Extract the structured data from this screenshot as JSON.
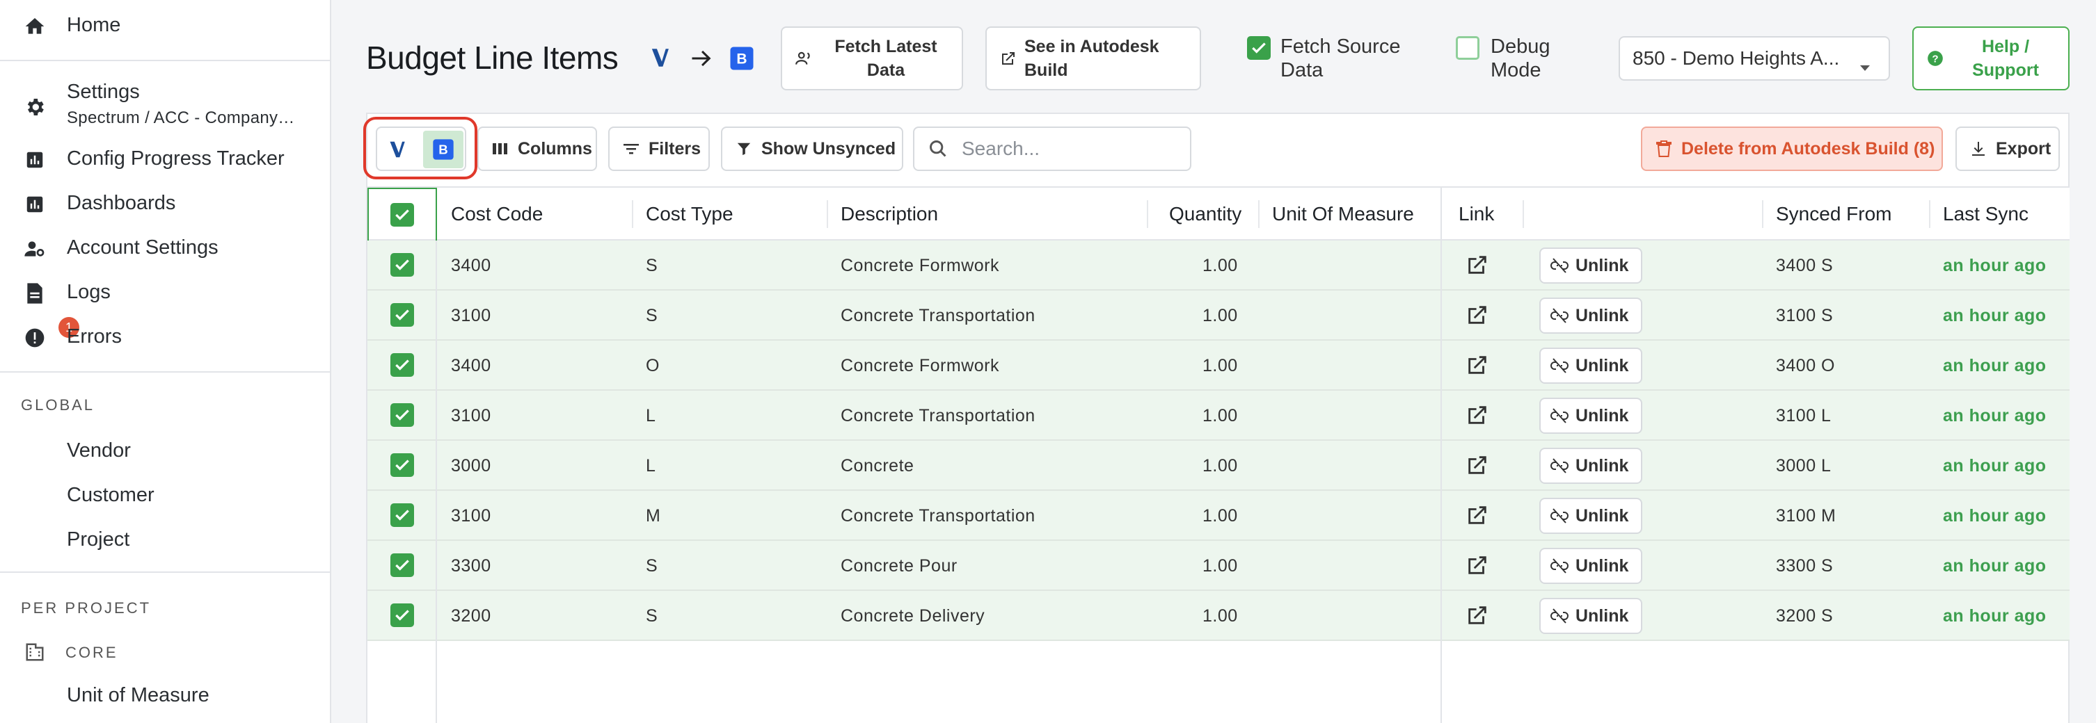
{
  "sidebar": {
    "home": "Home",
    "settings": "Settings",
    "settings_sub": "Spectrum / ACC - Company…",
    "config_tracker": "Config Progress Tracker",
    "dashboards": "Dashboards",
    "account_settings": "Account Settings",
    "logs": "Logs",
    "errors": "Errors",
    "errors_count": "1",
    "global_title": "GLOBAL",
    "global_items": [
      "Vendor",
      "Customer",
      "Project"
    ],
    "per_project_title": "PER PROJECT",
    "core_title": "CORE",
    "unit_of_measure": "Unit of Measure"
  },
  "header": {
    "title": "Budget Line Items",
    "fetch_latest": "Fetch Latest Data",
    "see_in_build": "See in Autodesk Build",
    "fetch_source_label": "Fetch Source Data",
    "debug_label": "Debug Mode",
    "project_select": "850 - Demo Heights A...",
    "help": "Help / Support"
  },
  "toolbar": {
    "columns": "Columns",
    "filters": "Filters",
    "show_unsynced": "Show Unsynced",
    "search_placeholder": "Search...",
    "delete_label": "Delete from Autodesk Build (8)",
    "export": "Export"
  },
  "table": {
    "headers": {
      "cost_code": "Cost Code",
      "cost_type": "Cost Type",
      "description": "Description",
      "quantity": "Quantity",
      "uom": "Unit Of Measure",
      "link": "Link",
      "synced_from": "Synced From",
      "last_sync": "Last Sync"
    },
    "unlink_label": "Unlink",
    "rows": [
      {
        "cost_code": "3400",
        "cost_type": "S",
        "description": "Concrete Formwork",
        "quantity": "1.00",
        "synced_from": "3400 S",
        "last_sync": "an hour ago"
      },
      {
        "cost_code": "3100",
        "cost_type": "S",
        "description": "Concrete Transportation",
        "quantity": "1.00",
        "synced_from": "3100 S",
        "last_sync": "an hour ago"
      },
      {
        "cost_code": "3400",
        "cost_type": "O",
        "description": "Concrete Formwork",
        "quantity": "1.00",
        "synced_from": "3400 O",
        "last_sync": "an hour ago"
      },
      {
        "cost_code": "3100",
        "cost_type": "L",
        "description": "Concrete Transportation",
        "quantity": "1.00",
        "synced_from": "3100 L",
        "last_sync": "an hour ago"
      },
      {
        "cost_code": "3000",
        "cost_type": "L",
        "description": "Concrete",
        "quantity": "1.00",
        "synced_from": "3000 L",
        "last_sync": "an hour ago"
      },
      {
        "cost_code": "3100",
        "cost_type": "M",
        "description": "Concrete Transportation",
        "quantity": "1.00",
        "synced_from": "3100 M",
        "last_sync": "an hour ago"
      },
      {
        "cost_code": "3300",
        "cost_type": "S",
        "description": "Concrete Pour",
        "quantity": "1.00",
        "synced_from": "3300 S",
        "last_sync": "an hour ago"
      },
      {
        "cost_code": "3200",
        "cost_type": "S",
        "description": "Concrete Delivery",
        "quantity": "1.00",
        "synced_from": "3200 S",
        "last_sync": "an hour ago"
      }
    ]
  },
  "colors": {
    "accent_green": "#3aa14a",
    "row_bg": "#edf6ee",
    "delete_bg": "#fde3de",
    "delete_text": "#d9532f",
    "highlight_ring": "#e0392b",
    "vista_blue": "#1d4f9c",
    "build_blue": "#2563eb"
  }
}
